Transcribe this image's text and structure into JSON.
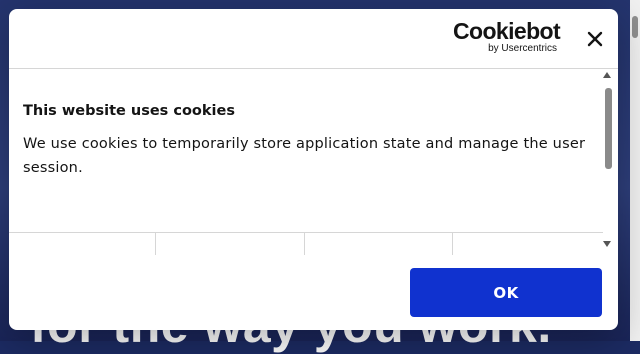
{
  "background": {
    "headline_fragment": "for the way you work."
  },
  "cookie_dialog": {
    "logo": {
      "wordmark": "Cookiebot",
      "subtitle": "by Usercentrics"
    },
    "close_icon": "close-icon",
    "title": "This website uses cookies",
    "description": "We use cookies to temporarily store application state and manage the user session.",
    "ok_label": "OK",
    "colors": {
      "ok_button": "#1032cf",
      "text": "#141414"
    }
  }
}
